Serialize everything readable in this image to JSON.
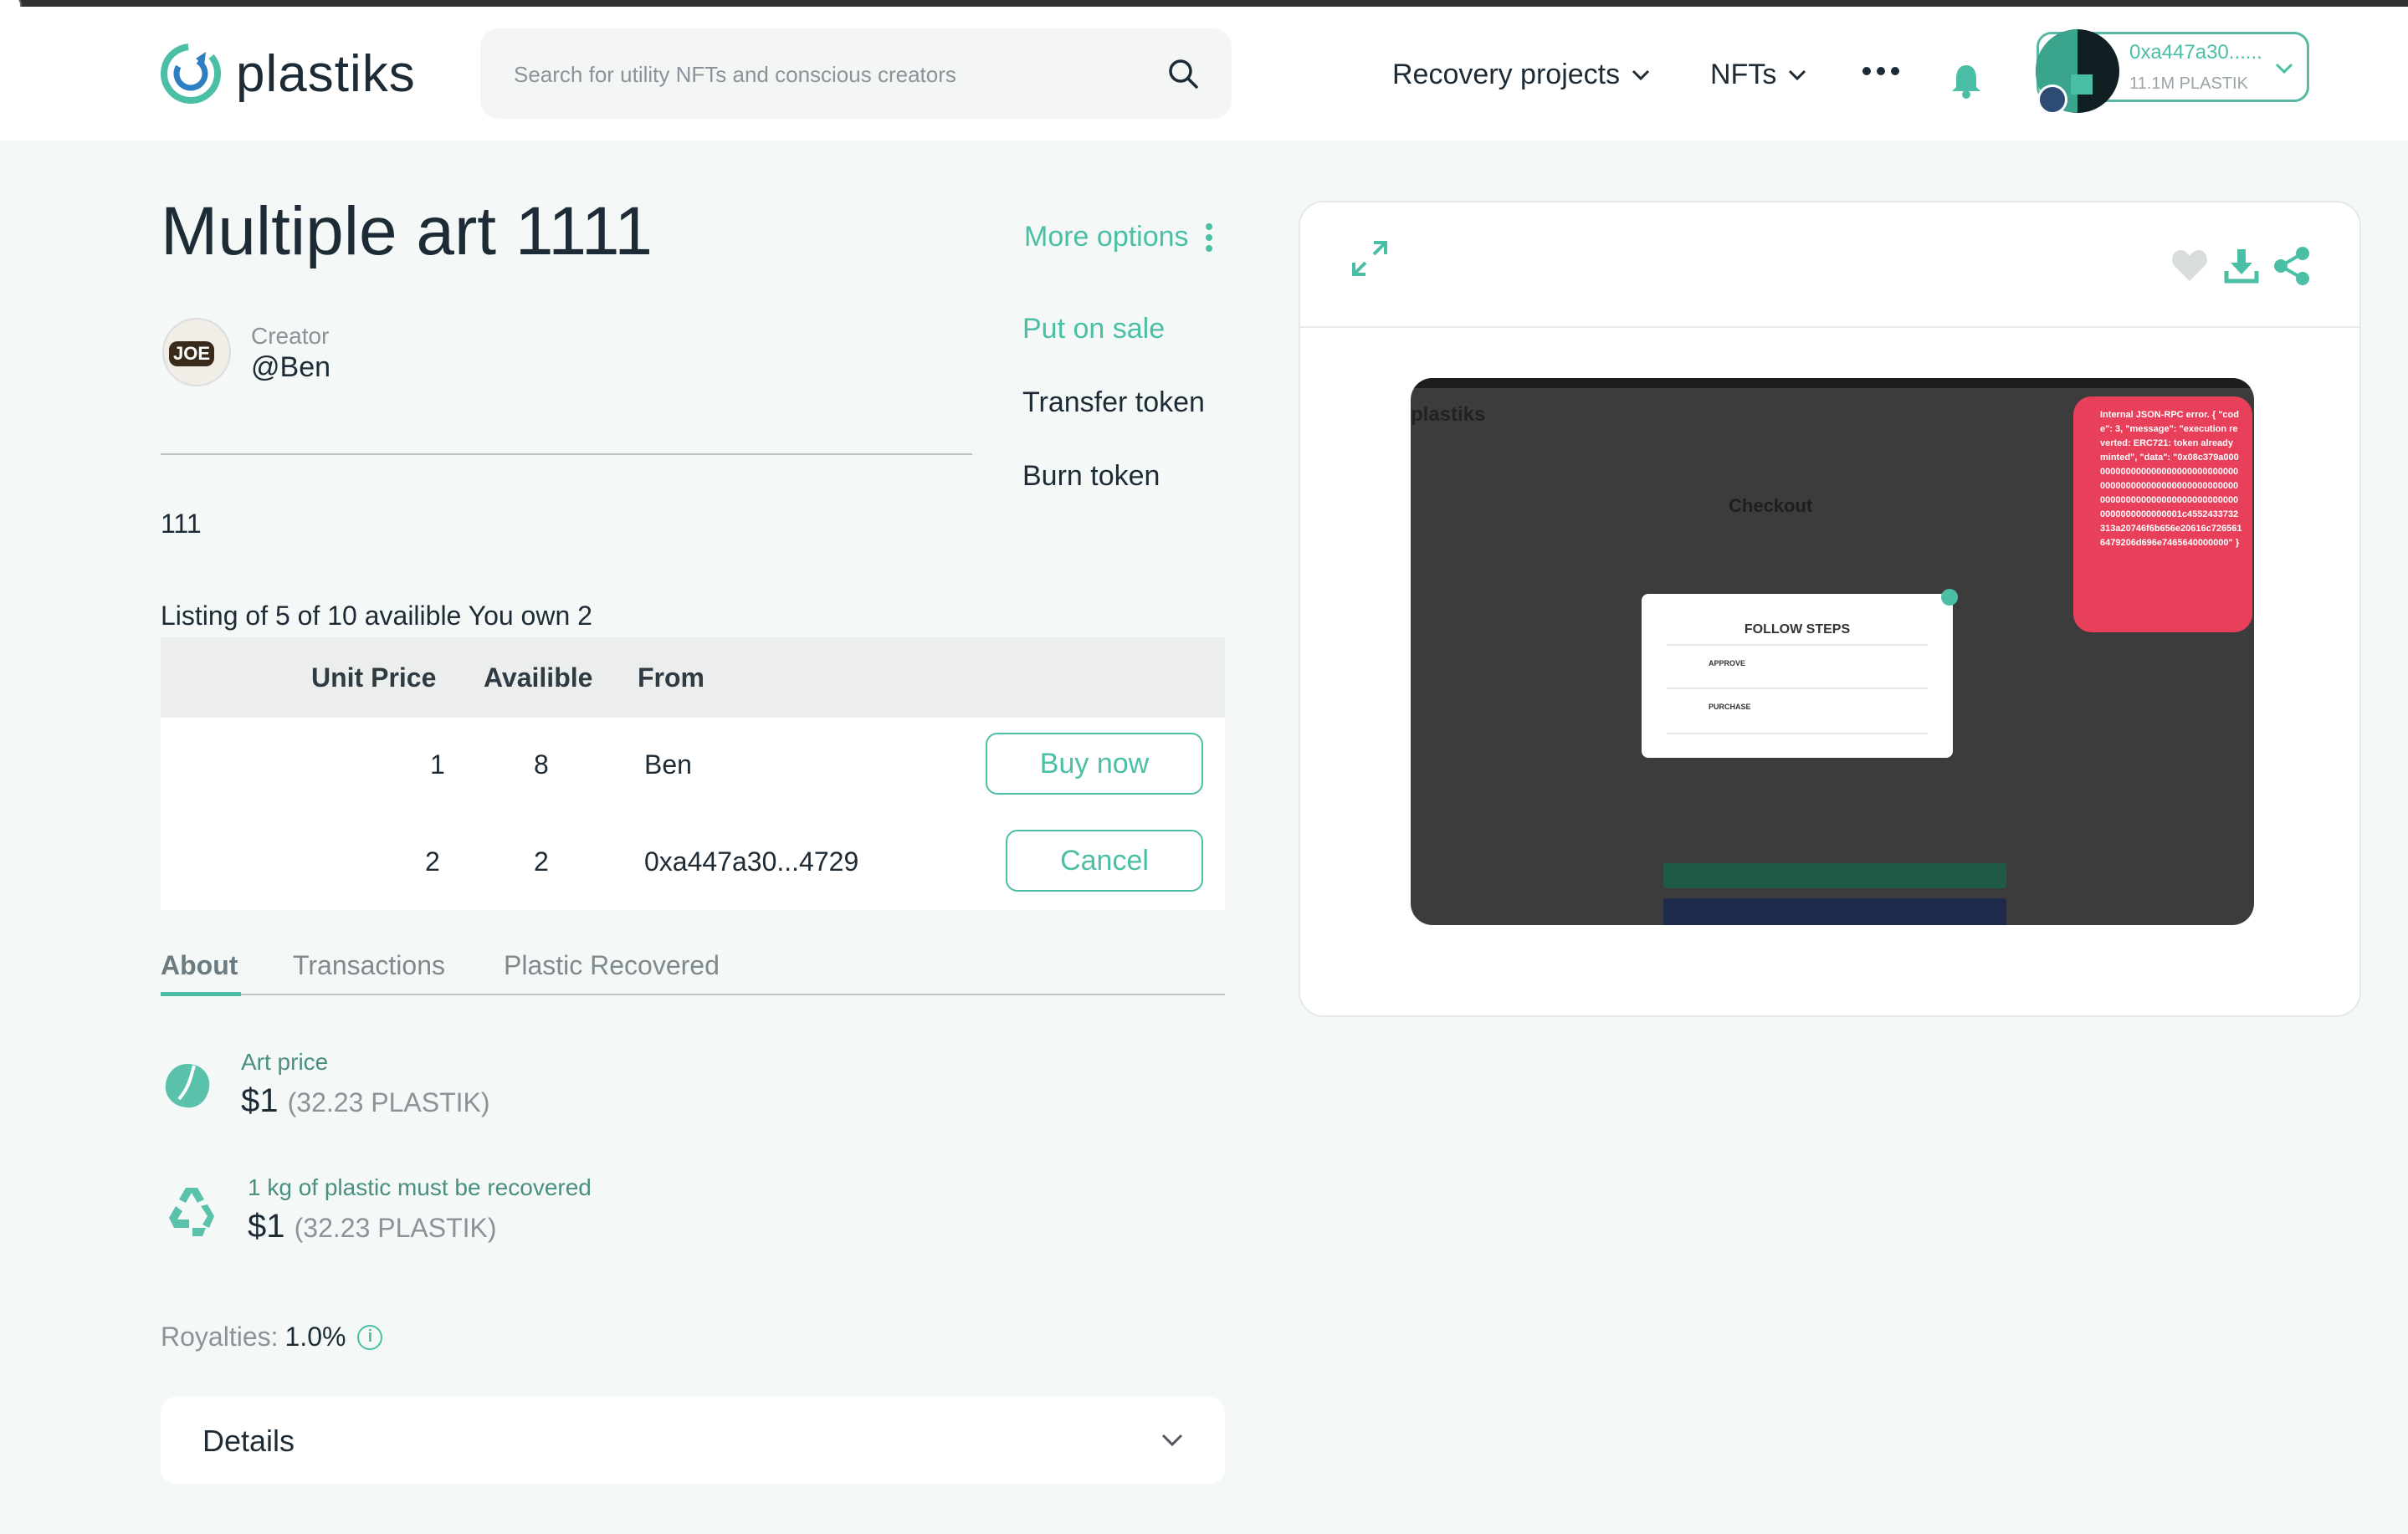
{
  "brand": {
    "name": "plastiks",
    "accent": "#4bbfa6"
  },
  "search": {
    "placeholder": "Search for utility NFTs and conscious creators",
    "icon": "search-icon"
  },
  "nav": {
    "recovery_projects": "Recovery projects",
    "nfts": "NFTs"
  },
  "wallet": {
    "address": "0xa447a30......",
    "balance": "11.1M PLASTIK"
  },
  "nft": {
    "title": "Multiple art 1111",
    "more_options": "More options",
    "creator_label": "Creator",
    "creator_name": "@Ben",
    "description": "111",
    "actions": [
      "Put on sale",
      "Transfer token",
      "Burn token"
    ],
    "listing_caption": "Listing of 5 of 10 availible You own 2"
  },
  "listings": {
    "headers": [
      "Unit Price",
      "Availible",
      "From"
    ],
    "rows": [
      {
        "price": "1",
        "available": "8",
        "from": "Ben",
        "action": "Buy now"
      },
      {
        "price": "2",
        "available": "2",
        "from": "0xa447a30...4729",
        "action": "Cancel"
      }
    ]
  },
  "tabs": [
    "About",
    "Transactions",
    "Plastic Recovered"
  ],
  "about": {
    "art_price_label": "Art price",
    "art_price_value": "$1",
    "art_price_plastik": "(32.23 PLASTIK)",
    "plastic_label": "1 kg of plastic must be recovered",
    "plastic_value": "$1",
    "plastic_plastik": "(32.23 PLASTIK)",
    "royalties_label": "Royalties:",
    "royalties_value": "1.0%",
    "details_label": "Details"
  },
  "preview_image": {
    "logo": "plastiks",
    "heading": "Checkout",
    "modal_title": "FOLLOW STEPS",
    "step1": "APPROVE",
    "step2": "PURCHASE",
    "error_text": "Internal JSON-RPC error. { \"code\": 3, \"message\": \"execution reverted: ERC721: token already minted\", \"data\": \"0x08c379a0000000000000000000000000000000000000000000000000000000000000000000000000000000000000000000000000001c4552433732313a20746f6b656e20616c7265616479206d696e7465640000000\" }"
  }
}
